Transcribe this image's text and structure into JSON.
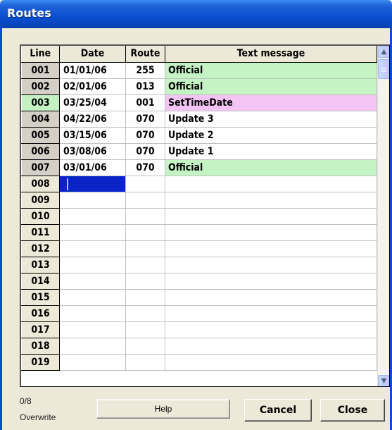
{
  "window": {
    "title": "Routes"
  },
  "grid": {
    "columns": [
      "Line",
      "Date",
      "Route",
      "Text message"
    ],
    "rows": [
      {
        "line": "001",
        "date": "01/01/06",
        "route": "255",
        "message": "Official",
        "style": "green"
      },
      {
        "line": "002",
        "date": "02/01/06",
        "route": "013",
        "message": "Official",
        "style": "green"
      },
      {
        "line": "003",
        "date": "03/25/04",
        "route": "001",
        "message": "SetTimeDate",
        "style": "pink"
      },
      {
        "line": "004",
        "date": "04/22/06",
        "route": "070",
        "message": "Update 3",
        "style": "plain"
      },
      {
        "line": "005",
        "date": "03/15/06",
        "route": "070",
        "message": "Update 2",
        "style": "plain"
      },
      {
        "line": "006",
        "date": "03/08/06",
        "route": "070",
        "message": "Update 1",
        "style": "plain"
      },
      {
        "line": "007",
        "date": "03/01/06",
        "route": "070",
        "message": "Official",
        "style": "green"
      },
      {
        "line": "008",
        "date": "",
        "route": "",
        "message": "",
        "style": "editing"
      },
      {
        "line": "009",
        "date": "",
        "route": "",
        "message": "",
        "style": "empty"
      },
      {
        "line": "010",
        "date": "",
        "route": "",
        "message": "",
        "style": "empty"
      },
      {
        "line": "011",
        "date": "",
        "route": "",
        "message": "",
        "style": "empty"
      },
      {
        "line": "012",
        "date": "",
        "route": "",
        "message": "",
        "style": "empty"
      },
      {
        "line": "013",
        "date": "",
        "route": "",
        "message": "",
        "style": "empty"
      },
      {
        "line": "014",
        "date": "",
        "route": "",
        "message": "",
        "style": "empty"
      },
      {
        "line": "015",
        "date": "",
        "route": "",
        "message": "",
        "style": "empty"
      },
      {
        "line": "016",
        "date": "",
        "route": "",
        "message": "",
        "style": "empty"
      },
      {
        "line": "017",
        "date": "",
        "route": "",
        "message": "",
        "style": "empty"
      },
      {
        "line": "018",
        "date": "",
        "route": "",
        "message": "",
        "style": "empty"
      },
      {
        "line": "019",
        "date": "",
        "route": "",
        "message": "",
        "style": "empty"
      }
    ]
  },
  "status": {
    "counter": "0/8",
    "mode": "Overwrite"
  },
  "buttons": {
    "help": "Help",
    "cancel": "Cancel",
    "close": "Close"
  },
  "icons": {
    "scroll_up": "arrow-up-icon",
    "scroll_down": "arrow-down-icon"
  },
  "colors": {
    "titlebar": "#0a4ecf",
    "row_green": "#c4f4c4",
    "row_pink": "#f4c4f4",
    "editing_cell": "#0a24c8",
    "window_bg": "#ece9d8"
  }
}
